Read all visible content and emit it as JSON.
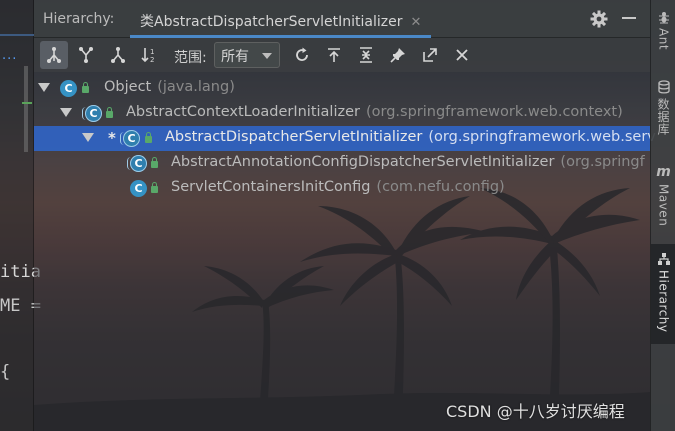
{
  "editor": {
    "tab_overflow": "...",
    "code_lines": [
      "itia",
      "ME =",
      "{"
    ]
  },
  "hierarchy": {
    "title": "Hierarchy:",
    "tab_label": "类AbstractDispatcherServletInitializer",
    "close_glyph": "✕",
    "toolbar": {
      "scope_label": "范围:",
      "scope_value": "所有"
    },
    "tree": [
      {
        "name": "Object",
        "package": "(java.lang)"
      },
      {
        "name": "AbstractContextLoaderInitializer",
        "package": "(org.springframework.web.context)"
      },
      {
        "marker": "*",
        "name": "AbstractDispatcherServletInitializer",
        "package": "(org.springframework.web.serv"
      },
      {
        "name": "AbstractAnnotationConfigDispatcherServletInitializer",
        "package": "(org.springf"
      },
      {
        "name": "ServletContainersInitConfig",
        "package": "(com.nefu.config)"
      }
    ],
    "class_icon_letter": "C"
  },
  "right_sidebar": {
    "tabs": [
      {
        "label": "Ant",
        "icon": "ant-icon"
      },
      {
        "label": "数据库",
        "icon": "database-icon"
      },
      {
        "label": "Maven",
        "icon": "maven-icon"
      },
      {
        "label": "Hierarchy",
        "icon": "hierarchy-icon",
        "active": true
      }
    ]
  },
  "watermark": "CSDN @十八岁讨厌编程",
  "colors": {
    "selection": "#2f65ca",
    "class_icon": "#3592c4",
    "tab_underline": "#4a88c7",
    "lock_green": "#59a869"
  }
}
